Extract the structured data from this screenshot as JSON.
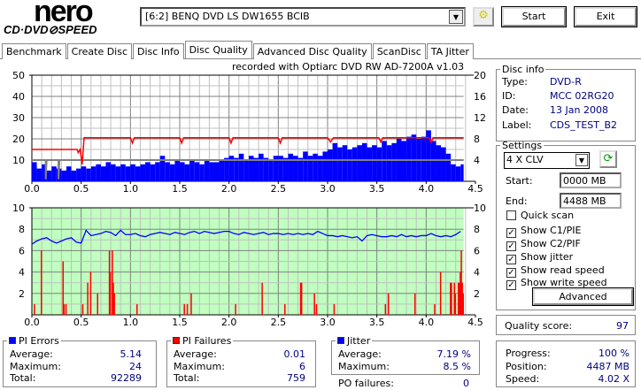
{
  "header": {
    "logo_top": "nero",
    "logo_bottom": "CD·DVD⊘SPEED",
    "drive": "[6:2]  BENQ DVD LS DW1655 BCIB",
    "start": "Start",
    "exit": "Exit"
  },
  "tabs": [
    "Benchmark",
    "Create Disc",
    "Disc Info",
    "Disc Quality",
    "Advanced Disc Quality",
    "ScanDisc",
    "TA Jitter"
  ],
  "active_tab": "Disc Quality",
  "recorded_with": "recorded with Optiarc DVD RW AD-7200A  v1.03",
  "disc_info": {
    "title": "Disc info",
    "type_label": "Type:",
    "type": "DVD-R",
    "id_label": "ID:",
    "id": "MCC 02RG20",
    "date_label": "Date:",
    "date": "13 Jan 2008",
    "label_label": "Label:",
    "label": "CDS_TEST_B2"
  },
  "settings": {
    "title": "Settings",
    "speed": "4 X CLV",
    "start_label": "Start:",
    "start": "0000 MB",
    "end_label": "End:",
    "end": "4488 MB",
    "checks": [
      {
        "label": "Quick scan",
        "checked": false
      },
      {
        "label": "Show C1/PIE",
        "checked": true
      },
      {
        "label": "Show C2/PIF",
        "checked": true
      },
      {
        "label": "Show jitter",
        "checked": true
      },
      {
        "label": "Show read speed",
        "checked": true
      },
      {
        "label": "Show write speed",
        "checked": true
      }
    ],
    "advanced": "Advanced"
  },
  "quality": {
    "label": "Quality score:",
    "value": "97"
  },
  "progress": {
    "progress_label": "Progress:",
    "progress": "100 %",
    "position_label": "Position:",
    "position": "4487 MB",
    "speed_label": "Speed:",
    "speed": "4.02 X"
  },
  "pi_errors": {
    "title": "PI Errors",
    "avg_label": "Average:",
    "avg": "5.14",
    "max_label": "Maximum:",
    "max": "24",
    "total_label": "Total:",
    "total": "92289",
    "color": "#0000ff"
  },
  "pi_failures": {
    "title": "PI Failures",
    "avg_label": "Average:",
    "avg": "0.01",
    "max_label": "Maximum:",
    "max": "6",
    "total_label": "Total:",
    "total": "759",
    "color": "#ff0000"
  },
  "jitter": {
    "title": "Jitter",
    "avg_label": "Average:",
    "avg": "7.19 %",
    "max_label": "Maximum:",
    "max": "8.5 %",
    "po_label": "PO failures:",
    "po": "0",
    "color": "#0000ff"
  },
  "chart_data": [
    {
      "type": "bar",
      "title": "PI Errors / read speed",
      "x_step": 0.05,
      "xlim": [
        0,
        4.5
      ],
      "ylim": [
        0,
        50
      ],
      "y2lim": [
        0,
        20
      ],
      "xticks": [
        "0.0",
        "0.5",
        "1.0",
        "1.5",
        "2.0",
        "2.5",
        "3.0",
        "3.5",
        "4.0",
        "4.5"
      ],
      "yticks": [
        "10",
        "20",
        "30",
        "40",
        "50"
      ],
      "y2ticks": [
        "4",
        "8",
        "12",
        "16",
        "20"
      ],
      "pie": [
        9,
        6,
        8,
        5,
        7,
        6,
        5,
        7,
        5,
        6,
        7,
        6,
        7,
        8,
        7,
        9,
        8,
        7,
        8,
        7,
        8,
        7,
        8,
        9,
        8,
        9,
        12,
        9,
        8,
        10,
        9,
        8,
        10,
        9,
        8,
        10,
        9,
        9,
        10,
        11,
        12,
        11,
        13,
        10,
        12,
        11,
        13,
        11,
        10,
        12,
        12,
        11,
        13,
        12,
        11,
        14,
        12,
        13,
        12,
        14,
        15,
        18,
        16,
        17,
        15,
        16,
        17,
        18,
        16,
        17,
        16,
        19,
        17,
        18,
        20,
        19,
        21,
        22,
        20,
        21,
        24,
        19,
        17,
        16,
        13,
        8,
        7,
        8
      ],
      "read_speed": [
        [
          0,
          6
        ],
        [
          0.46,
          6
        ],
        [
          0.47,
          5.4
        ],
        [
          0.49,
          6
        ],
        [
          0.51,
          3.2
        ],
        [
          0.53,
          8.2
        ],
        [
          1.0,
          8.2
        ],
        [
          1.02,
          7.2
        ],
        [
          1.04,
          8.2
        ],
        [
          1.5,
          8.2
        ],
        [
          1.52,
          7.2
        ],
        [
          1.54,
          8.2
        ],
        [
          2.0,
          8.2
        ],
        [
          2.02,
          7.2
        ],
        [
          2.04,
          8.2
        ],
        [
          2.5,
          8.2
        ],
        [
          2.52,
          7.2
        ],
        [
          2.54,
          8.2
        ],
        [
          3.0,
          8.2
        ],
        [
          3.03,
          7.4
        ],
        [
          3.06,
          8.2
        ],
        [
          3.52,
          8.2
        ],
        [
          3.54,
          7.4
        ],
        [
          3.56,
          8.2
        ],
        [
          4.03,
          8.2
        ],
        [
          4.05,
          7.3
        ],
        [
          4.07,
          8.2
        ],
        [
          4.38,
          8.2
        ]
      ],
      "write_speed": [
        [
          0,
          4
        ],
        [
          0.14,
          4
        ],
        [
          0.14,
          0.4
        ],
        [
          0.15,
          4
        ],
        [
          0.27,
          4
        ],
        [
          0.27,
          0.4
        ],
        [
          0.28,
          4
        ],
        [
          4.38,
          4
        ]
      ]
    },
    {
      "type": "bar",
      "title": "PI Failures / jitter",
      "x_step": 0.05,
      "xlim": [
        0,
        4.5
      ],
      "ylim": [
        0,
        10
      ],
      "y2lim": [
        0,
        10
      ],
      "xticks": [
        "0.0",
        "0.5",
        "1.0",
        "1.5",
        "2.0",
        "2.5",
        "3.0",
        "3.5",
        "4.0",
        "4.5"
      ],
      "yticks": [
        "2",
        "4",
        "6",
        "8",
        "10"
      ],
      "y2ticks": [
        "2",
        "4",
        "6",
        "8",
        "10"
      ],
      "jitter": [
        6.6,
        6.9,
        7.1,
        7.2,
        6.9,
        6.7,
        6.9,
        7.1,
        7.2,
        6.8,
        6.7,
        7.9,
        7.4,
        7.5,
        7.6,
        7.8,
        7.7,
        7.4,
        7.9,
        7.5,
        7.5,
        7.6,
        7.4,
        7.3,
        7.5,
        7.6,
        7.7,
        7.6,
        7.5,
        7.7,
        7.6,
        7.5,
        7.7,
        7.8,
        7.6,
        7.8,
        7.7,
        7.6,
        7.7,
        7.8,
        7.8,
        7.6,
        7.5,
        7.7,
        7.6,
        7.5,
        7.6,
        7.7,
        7.5,
        7.6,
        7.6,
        7.5,
        7.6,
        7.5,
        7.6,
        7.5,
        7.6,
        7.5,
        7.8,
        7.6,
        7.4,
        7.4,
        7.3,
        7.4,
        7.3,
        7.2,
        7.3,
        6.9,
        7.4,
        7.5,
        7.4,
        7.3,
        7.3,
        7.4,
        7.3,
        7.5,
        7.3,
        7.4,
        7.3,
        7.4,
        7.4,
        7.6,
        7.4,
        7.3,
        7.4,
        7.3,
        7.5,
        7.8
      ],
      "pif": [
        [
          0.02,
          1
        ],
        [
          0.09,
          6
        ],
        [
          0.31,
          5
        ],
        [
          0.32,
          1
        ],
        [
          0.34,
          1
        ],
        [
          0.51,
          1
        ],
        [
          0.56,
          3
        ],
        [
          0.59,
          4
        ],
        [
          0.66,
          2
        ],
        [
          0.78,
          6
        ],
        [
          0.79,
          4
        ],
        [
          0.81,
          6
        ],
        [
          0.82,
          3
        ],
        [
          0.83,
          2
        ],
        [
          1.06,
          1
        ],
        [
          1.54,
          1
        ],
        [
          1.57,
          1
        ],
        [
          1.61,
          2
        ],
        [
          2.06,
          1
        ],
        [
          2.33,
          3
        ],
        [
          2.56,
          1
        ],
        [
          2.72,
          3
        ],
        [
          2.73,
          3
        ],
        [
          2.86,
          2
        ],
        [
          2.88,
          1
        ],
        [
          3.06,
          1
        ],
        [
          3.58,
          1
        ],
        [
          3.61,
          2
        ],
        [
          3.88,
          2
        ],
        [
          4.08,
          1
        ],
        [
          4.14,
          4
        ],
        [
          4.24,
          3
        ],
        [
          4.25,
          3
        ],
        [
          4.28,
          3
        ],
        [
          4.29,
          2
        ],
        [
          4.32,
          3
        ],
        [
          4.33,
          3
        ],
        [
          4.34,
          4
        ],
        [
          4.35,
          6
        ],
        [
          4.36,
          3
        ],
        [
          4.37,
          2
        ]
      ]
    }
  ]
}
